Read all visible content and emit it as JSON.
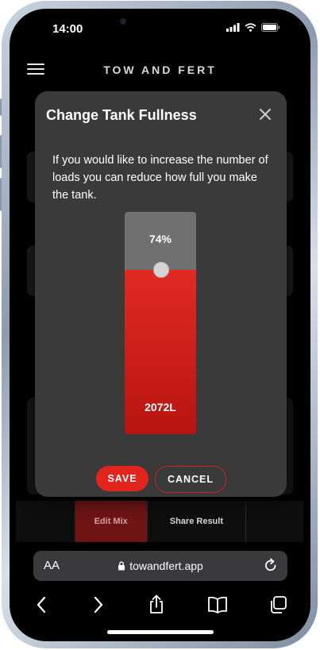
{
  "status_bar": {
    "time": "14:00"
  },
  "header": {
    "brand": "TOW AND FERT"
  },
  "modal": {
    "title": "Change Tank Fullness",
    "message": "If you would like to increase the number of loads you can reduce how full you make the tank.",
    "tank": {
      "percent_label": "74%",
      "fill_fraction": 0.74,
      "liters_label": "2072L"
    },
    "save_label": "SAVE",
    "cancel_label": "CANCEL"
  },
  "tabs": [
    {
      "label": "Edit Mix",
      "active": true
    },
    {
      "label": "Share Result",
      "active": false
    }
  ],
  "browser": {
    "aa_label": "AA",
    "url": "towandfert.app"
  },
  "colors": {
    "accent": "#e3241c",
    "modal_bg": "#3a3a3a",
    "tank_empty": "#707070"
  }
}
